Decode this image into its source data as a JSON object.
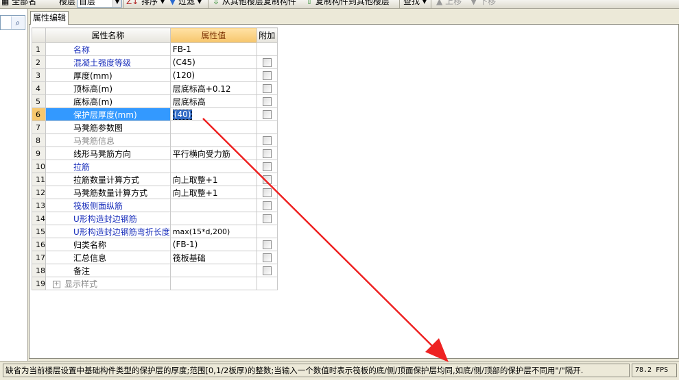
{
  "toolbar": {
    "rename_all": "全部名",
    "floor_label": "楼层",
    "floor_value": "首层",
    "sort": "排序",
    "filter": "过滤",
    "copy_from_other_floors": "从其他楼层复制构件",
    "copy_to_other_floors": "复制构件到其他楼层",
    "find": "查找",
    "move_up": "上移",
    "move_down": "下移"
  },
  "tab": {
    "label": "属性编辑"
  },
  "table": {
    "header_name": "属性名称",
    "header_value": "属性值",
    "header_extra": "附加",
    "rows": [
      {
        "num": "1",
        "name": "名称",
        "value": "FB-1"
      },
      {
        "num": "2",
        "name": "混凝土强度等级",
        "value": "(C45)"
      },
      {
        "num": "3",
        "name": "厚度(mm)",
        "value": "(120)"
      },
      {
        "num": "4",
        "name": "顶标高(m)",
        "value": "层底标高+0.12"
      },
      {
        "num": "5",
        "name": "底标高(m)",
        "value": "层底标高"
      },
      {
        "num": "6",
        "name": "保护层厚度(mm)",
        "value": "(40)"
      },
      {
        "num": "7",
        "name": "马凳筋参数图",
        "value": ""
      },
      {
        "num": "8",
        "name": "马凳筋信息",
        "value": ""
      },
      {
        "num": "9",
        "name": "线形马凳筋方向",
        "value": "平行横向受力筋"
      },
      {
        "num": "10",
        "name": "拉筋",
        "value": ""
      },
      {
        "num": "11",
        "name": "拉筋数量计算方式",
        "value": "向上取整+1"
      },
      {
        "num": "12",
        "name": "马凳筋数量计算方式",
        "value": "向上取整+1"
      },
      {
        "num": "13",
        "name": "筏板侧面纵筋",
        "value": ""
      },
      {
        "num": "14",
        "name": "U形构造封边钢筋",
        "value": ""
      },
      {
        "num": "15",
        "name": "U形构造封边钢筋弯折长度",
        "value": "max(15*d,200)"
      },
      {
        "num": "16",
        "name": "归类名称",
        "value": "(FB-1)"
      },
      {
        "num": "17",
        "name": "汇总信息",
        "value": "筏板基础"
      },
      {
        "num": "18",
        "name": "备注",
        "value": ""
      },
      {
        "num": "19",
        "name": "显示样式",
        "value": ""
      }
    ]
  },
  "status": {
    "message": "缺省为当前楼层设置中基础构件类型的保护层的厚度;范围[0,1/2板厚)的整数;当输入一个数值时表示筏板的底/侧/顶面保护层均同,如底/侧/顶部的保护层不同用\"/\"隔开.",
    "fps": "78.2 FPS"
  },
  "colors": {
    "arrow": "#ee2222",
    "selection": "#3399ff",
    "link_text": "#1a2fbb"
  },
  "icons": [
    "search-icon",
    "sort-icon",
    "filter-icon",
    "copy-from-icon",
    "copy-to-icon",
    "move-up-icon",
    "move-down-icon",
    "expand-icon"
  ]
}
